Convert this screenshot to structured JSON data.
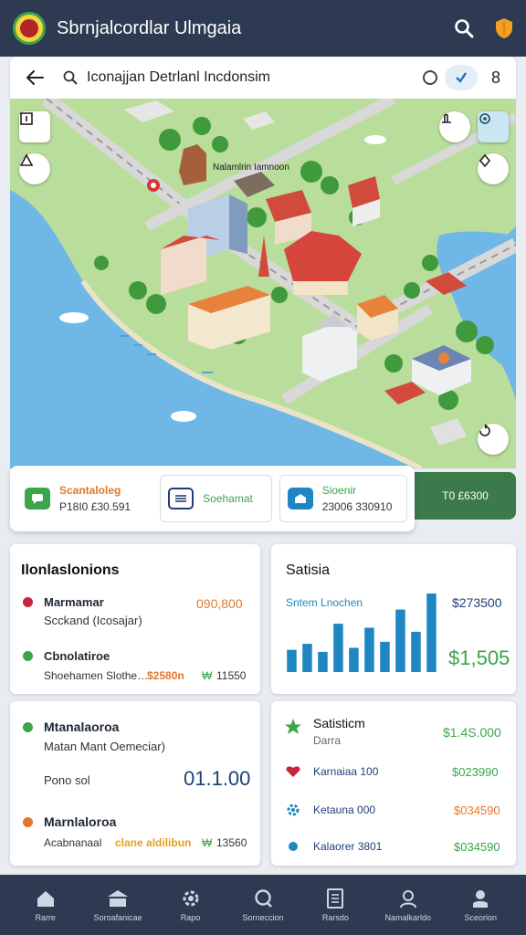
{
  "header": {
    "app_title": "Sbrnjalcordlar Ulmgaia"
  },
  "search": {
    "query": "Iconajjan Detrlanl Incdonsim",
    "result_count": "8"
  },
  "map": {
    "place_label": "Nalamlrin Iamnoon"
  },
  "summary_strip": {
    "item1_title": "Scantaloleg",
    "item1_value": "P18I0 £30.591",
    "item2_title": "Soehamat",
    "item3_title": "Sioenir",
    "item3_value": "23006 330910",
    "green_value": "T0 £6300"
  },
  "card_left_top": {
    "title": "Ilonlaslonions",
    "row1_label": "Marmamar",
    "row1_sub": "Scckand (Icosajar)",
    "row1_amount": "090,800",
    "row2_label": "Cbnolatiroe",
    "row2_sub": "Shoehamen Slothe…",
    "row2_highlight": "$2580n",
    "row2_badge": "₩",
    "row2_amount": "11550"
  },
  "card_right_top": {
    "title": "Satisia",
    "chart_label": "Sntem Lnochen",
    "chart_top_value": "$273500",
    "chart_big_value": "$1,505",
    "chart_data": {
      "type": "bar",
      "values": [
        22,
        28,
        20,
        48,
        24,
        44,
        30,
        62,
        40,
        78
      ],
      "color": "#1f86c2"
    }
  },
  "card_left_bottom": {
    "row1_label": "Mtanalaoroa",
    "row1_sub": "Matan Mant Oemeciar)",
    "row1_note": "Pono sol",
    "row1_amount": "01.1.00",
    "row2_label": "Marnlaloroa",
    "row2_sub": "Acabnanaal",
    "row2_highlight": "clane aldilibun",
    "row2_badge": "₩",
    "row2_amount": "13560"
  },
  "card_right_bottom": {
    "title": "Satisticm",
    "subtitle": "Darra",
    "title_amount": "$1.4S.000",
    "row1_label": "Karnaiaa 100",
    "row1_amount": "$023990",
    "row2_label": "Ketauna 000",
    "row2_amount": "$034590",
    "row3_label": "Kalaorer 3801",
    "row3_amount": "$034590"
  },
  "nav": {
    "items": [
      {
        "label": "Rarre",
        "icon": "home-icon"
      },
      {
        "label": "Soroafanicae",
        "icon": "landmark-icon"
      },
      {
        "label": "Rapo",
        "icon": "gear-icon"
      },
      {
        "label": "Sorneccion",
        "icon": "search-icon"
      },
      {
        "label": "Rarsdo",
        "icon": "document-icon"
      },
      {
        "label": "Namalkarldo",
        "icon": "person-icon"
      },
      {
        "label": "Sceorion",
        "icon": "user-pin-icon"
      }
    ]
  },
  "colors": {
    "topbar": "#2d3a52",
    "green": "#3aa54a",
    "orange": "#e2782a",
    "blue": "#1f86c2",
    "navy": "#1f3f7a",
    "red_dot": "#c8243d"
  }
}
